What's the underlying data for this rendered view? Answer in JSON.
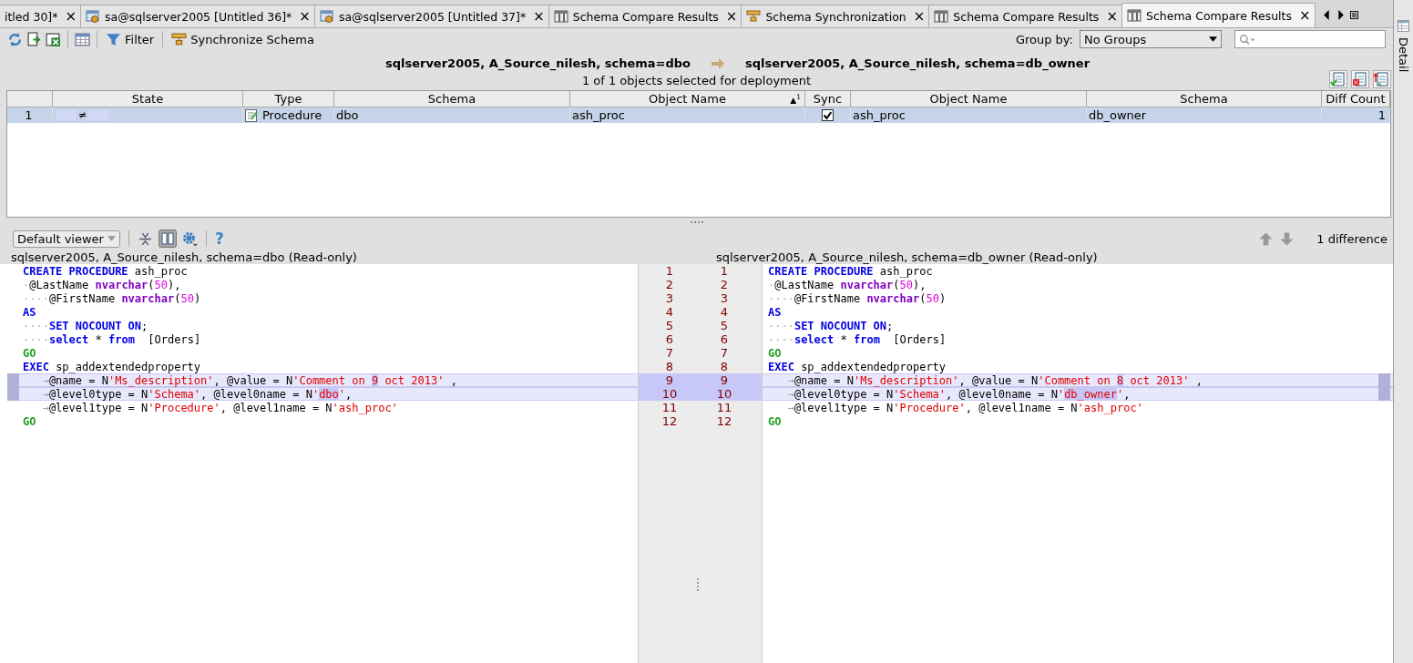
{
  "tabs": [
    {
      "label": "itled 30]*",
      "kind": "plain",
      "close": "×",
      "selected": false
    },
    {
      "label": "sa@sqlserver2005 [Untitled 36]*",
      "kind": "query",
      "close": "×",
      "selected": false
    },
    {
      "label": "sa@sqlserver2005 [Untitled 37]*",
      "kind": "query",
      "close": "×",
      "selected": false
    },
    {
      "label": "Schema Compare Results",
      "kind": "compare",
      "close": "×",
      "selected": false
    },
    {
      "label": "Schema Synchronization",
      "kind": "sync",
      "close": "×",
      "selected": false
    },
    {
      "label": "Schema Compare Results",
      "kind": "compare",
      "close": "×",
      "selected": false
    },
    {
      "label": "Schema Compare Results",
      "kind": "compare",
      "close": "×",
      "selected": true
    }
  ],
  "toolbar": {
    "filter": "Filter",
    "synchronize": "Synchronize Schema",
    "group_by_label": "Group by:",
    "group_by_value": "No Groups"
  },
  "side_panel": {
    "label": "Detail"
  },
  "header": {
    "source": "sqlserver2005, A_Source_nilesh,  schema=dbo",
    "target": "sqlserver2005, A_Source_nilesh,  schema=db_owner",
    "summary": "1 of 1 objects selected for deployment"
  },
  "table": {
    "columns": [
      "",
      "State",
      "Type",
      "Schema",
      "Object Name",
      "Sync",
      "Object Name",
      "Schema",
      "Diff Count"
    ],
    "sort_mark": "▲$^{1}$",
    "rows": [
      {
        "number": "1",
        "state": "≠",
        "type": "Procedure",
        "schema": "dbo",
        "object_name": "ash_proc",
        "sync": true,
        "target_object_name": "ash_proc",
        "target_schema": "db_owner",
        "diff_count": "1",
        "selected": true
      }
    ]
  },
  "diff": {
    "viewer": "Default viewer",
    "help": "?",
    "difference_count": "1 difference",
    "left_title": "sqlserver2005, A_Source_nilesh, schema=dbo (Read-only)",
    "right_title": "sqlserver2005, A_Source_nilesh, schema=db_owner (Read-only)",
    "left_lines": [
      {
        "number": "1",
        "changed": false,
        "tokens": [
          {
            "kind": "keyword",
            "text": "CREATE PROCEDURE"
          },
          {
            "kind": "plain",
            "text": " ash_proc"
          }
        ]
      },
      {
        "number": "2",
        "changed": false,
        "tokens": [
          {
            "kind": "space",
            "text": "·"
          },
          {
            "kind": "plain",
            "text": "@LastName "
          },
          {
            "kind": "type",
            "text": "nvarchar"
          },
          {
            "kind": "plain",
            "text": "("
          },
          {
            "kind": "number",
            "text": "50"
          },
          {
            "kind": "plain",
            "text": "),"
          }
        ]
      },
      {
        "number": "3",
        "changed": false,
        "tokens": [
          {
            "kind": "space",
            "text": "····"
          },
          {
            "kind": "plain",
            "text": "@FirstName "
          },
          {
            "kind": "type",
            "text": "nvarchar"
          },
          {
            "kind": "plain",
            "text": "("
          },
          {
            "kind": "number",
            "text": "50"
          },
          {
            "kind": "plain",
            "text": ")"
          }
        ]
      },
      {
        "number": "4",
        "changed": false,
        "tokens": [
          {
            "kind": "keyword",
            "text": "AS"
          }
        ]
      },
      {
        "number": "5",
        "changed": false,
        "tokens": [
          {
            "kind": "space",
            "text": "····"
          },
          {
            "kind": "keyword",
            "text": "SET NOCOUNT ON"
          },
          {
            "kind": "plain",
            "text": ";"
          }
        ]
      },
      {
        "number": "6",
        "changed": false,
        "tokens": [
          {
            "kind": "space",
            "text": "····"
          },
          {
            "kind": "keyword",
            "text": "select"
          },
          {
            "kind": "plain",
            "text": " * "
          },
          {
            "kind": "keyword",
            "text": "from"
          },
          {
            "kind": "plain",
            "text": "  [Orders]"
          }
        ]
      },
      {
        "number": "7",
        "changed": false,
        "tokens": [
          {
            "kind": "go",
            "text": "GO"
          }
        ]
      },
      {
        "number": "8",
        "changed": false,
        "tokens": [
          {
            "kind": "keyword",
            "text": "EXEC"
          },
          {
            "kind": "plain",
            "text": " sp_addextendedproperty"
          }
        ]
      },
      {
        "number": "9",
        "changed": true,
        "tokens": [
          {
            "kind": "tab",
            "text": "→"
          },
          {
            "kind": "plain",
            "text": "@name = N"
          },
          {
            "kind": "string",
            "text": "'Ms_description'"
          },
          {
            "kind": "plain",
            "text": ", @value = N"
          },
          {
            "kind": "string",
            "text": "'Comment on "
          },
          {
            "kind": "diff",
            "text": "9"
          },
          {
            "kind": "string",
            "text": " oct 2013'"
          },
          {
            "kind": "plain",
            "text": " ,"
          }
        ]
      },
      {
        "number": "10",
        "changed": true,
        "tokens": [
          {
            "kind": "tab",
            "text": "→"
          },
          {
            "kind": "plain",
            "text": "@level0type = N"
          },
          {
            "kind": "string",
            "text": "'Schema'"
          },
          {
            "kind": "plain",
            "text": ", @level0name = N"
          },
          {
            "kind": "string",
            "text": "'"
          },
          {
            "kind": "diff",
            "text": "dbo"
          },
          {
            "kind": "string",
            "text": "'"
          },
          {
            "kind": "plain",
            "text": ","
          }
        ]
      },
      {
        "number": "11",
        "changed": false,
        "tokens": [
          {
            "kind": "tab",
            "text": "→"
          },
          {
            "kind": "plain",
            "text": "@level1type = N"
          },
          {
            "kind": "string",
            "text": "'Procedure'"
          },
          {
            "kind": "plain",
            "text": ", @level1name = N"
          },
          {
            "kind": "string",
            "text": "'ash_proc'"
          }
        ]
      },
      {
        "number": "12",
        "changed": false,
        "tokens": [
          {
            "kind": "go",
            "text": "GO"
          }
        ]
      }
    ],
    "right_lines": [
      {
        "number": "1",
        "changed": false,
        "tokens": [
          {
            "kind": "keyword",
            "text": "CREATE PROCEDURE"
          },
          {
            "kind": "plain",
            "text": " ash_proc"
          }
        ]
      },
      {
        "number": "2",
        "changed": false,
        "tokens": [
          {
            "kind": "space",
            "text": "·"
          },
          {
            "kind": "plain",
            "text": "@LastName "
          },
          {
            "kind": "type",
            "text": "nvarchar"
          },
          {
            "kind": "plain",
            "text": "("
          },
          {
            "kind": "number",
            "text": "50"
          },
          {
            "kind": "plain",
            "text": "),"
          }
        ]
      },
      {
        "number": "3",
        "changed": false,
        "tokens": [
          {
            "kind": "space",
            "text": "····"
          },
          {
            "kind": "plain",
            "text": "@FirstName "
          },
          {
            "kind": "type",
            "text": "nvarchar"
          },
          {
            "kind": "plain",
            "text": "("
          },
          {
            "kind": "number",
            "text": "50"
          },
          {
            "kind": "plain",
            "text": ")"
          }
        ]
      },
      {
        "number": "4",
        "changed": false,
        "tokens": [
          {
            "kind": "keyword",
            "text": "AS"
          }
        ]
      },
      {
        "number": "5",
        "changed": false,
        "tokens": [
          {
            "kind": "space",
            "text": "····"
          },
          {
            "kind": "keyword",
            "text": "SET NOCOUNT ON"
          },
          {
            "kind": "plain",
            "text": ";"
          }
        ]
      },
      {
        "number": "6",
        "changed": false,
        "tokens": [
          {
            "kind": "space",
            "text": "····"
          },
          {
            "kind": "keyword",
            "text": "select"
          },
          {
            "kind": "plain",
            "text": " * "
          },
          {
            "kind": "keyword",
            "text": "from"
          },
          {
            "kind": "plain",
            "text": "  [Orders]"
          }
        ]
      },
      {
        "number": "7",
        "changed": false,
        "tokens": [
          {
            "kind": "go",
            "text": "GO"
          }
        ]
      },
      {
        "number": "8",
        "changed": false,
        "tokens": [
          {
            "kind": "keyword",
            "text": "EXEC"
          },
          {
            "kind": "plain",
            "text": " sp_addextendedproperty"
          }
        ]
      },
      {
        "number": "9",
        "changed": true,
        "tokens": [
          {
            "kind": "tab",
            "text": "→"
          },
          {
            "kind": "plain",
            "text": "@name = N"
          },
          {
            "kind": "string",
            "text": "'Ms_description'"
          },
          {
            "kind": "plain",
            "text": ", @value = N"
          },
          {
            "kind": "string",
            "text": "'Comment on "
          },
          {
            "kind": "diff",
            "text": "8"
          },
          {
            "kind": "string",
            "text": " oct 2013'"
          },
          {
            "kind": "plain",
            "text": " ,"
          }
        ]
      },
      {
        "number": "10",
        "changed": true,
        "tokens": [
          {
            "kind": "tab",
            "text": "→"
          },
          {
            "kind": "plain",
            "text": "@level0type = N"
          },
          {
            "kind": "string",
            "text": "'Schema'"
          },
          {
            "kind": "plain",
            "text": ", @level0name = N"
          },
          {
            "kind": "string",
            "text": "'"
          },
          {
            "kind": "diff",
            "text": "db_owner"
          },
          {
            "kind": "string",
            "text": "'"
          },
          {
            "kind": "plain",
            "text": ","
          }
        ]
      },
      {
        "number": "11",
        "changed": false,
        "tokens": [
          {
            "kind": "tab",
            "text": "→"
          },
          {
            "kind": "plain",
            "text": "@level1type = N"
          },
          {
            "kind": "string",
            "text": "'Procedure'"
          },
          {
            "kind": "plain",
            "text": ", @level1name = N"
          },
          {
            "kind": "string",
            "text": "'ash_proc'"
          }
        ]
      },
      {
        "number": "12",
        "changed": false,
        "tokens": [
          {
            "kind": "go",
            "text": "GO"
          }
        ]
      }
    ]
  }
}
